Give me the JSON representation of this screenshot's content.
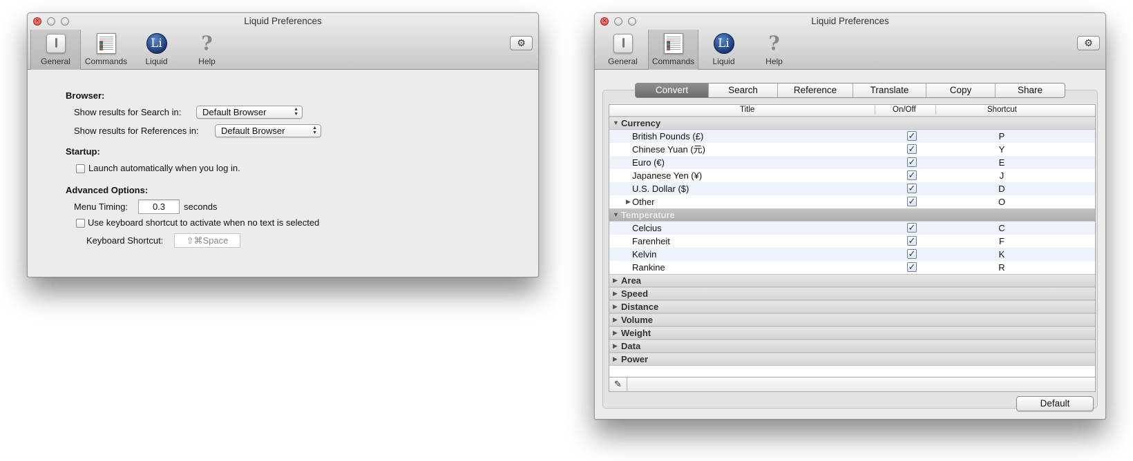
{
  "window_left": {
    "title": "Liquid Preferences",
    "toolbar": [
      {
        "label": "General",
        "icon": "general-icon",
        "selected": true
      },
      {
        "label": "Commands",
        "icon": "commands-icon",
        "selected": false
      },
      {
        "label": "Liquid",
        "icon": "liquid-icon",
        "selected": false
      },
      {
        "label": "Help",
        "icon": "help-icon",
        "selected": false
      }
    ],
    "liquid_icon_glyph": "Li",
    "help_icon_glyph": "?",
    "gear_glyph": "⚙",
    "browser": {
      "heading": "Browser:",
      "search_label": "Show results for Search in:",
      "search_value": "Default Browser",
      "references_label": "Show results for References in:",
      "references_value": "Default Browser"
    },
    "startup": {
      "heading": "Startup:",
      "launch_label": "Launch automatically when you log in."
    },
    "advanced": {
      "heading": "Advanced Options:",
      "menu_timing_label": "Menu Timing:",
      "menu_timing_value": "0.3",
      "menu_timing_unit": "seconds",
      "shortcut_checkbox_label": "Use keyboard shortcut to activate when no text is selected",
      "keyboard_shortcut_label": "Keyboard Shortcut:",
      "keyboard_shortcut_value": "⇧⌘Space"
    }
  },
  "window_right": {
    "title": "Liquid Preferences",
    "toolbar": [
      {
        "label": "General",
        "icon": "general-icon",
        "selected": false
      },
      {
        "label": "Commands",
        "icon": "commands-icon",
        "selected": true
      },
      {
        "label": "Liquid",
        "icon": "liquid-icon",
        "selected": false
      },
      {
        "label": "Help",
        "icon": "help-icon",
        "selected": false
      }
    ],
    "liquid_icon_glyph": "Li",
    "help_icon_glyph": "?",
    "gear_glyph": "⚙",
    "tabs": [
      "Convert",
      "Search",
      "Reference",
      "Translate",
      "Copy",
      "Share"
    ],
    "active_tab": "Convert",
    "columns": [
      "Title",
      "On/Off",
      "Shortcut"
    ],
    "rows": [
      {
        "type": "group",
        "label": "Currency",
        "expanded": true,
        "selected": false
      },
      {
        "type": "item",
        "label": "British Pounds (£)",
        "checked": true,
        "shortcut": "P"
      },
      {
        "type": "item",
        "label": "Chinese Yuan (元)",
        "checked": true,
        "shortcut": "Y"
      },
      {
        "type": "item",
        "label": "Euro (€)",
        "checked": true,
        "shortcut": "E"
      },
      {
        "type": "item",
        "label": "Japanese Yen (¥)",
        "checked": true,
        "shortcut": "J"
      },
      {
        "type": "item",
        "label": "U.S. Dollar ($)",
        "checked": true,
        "shortcut": "D"
      },
      {
        "type": "subgroup",
        "label": "Other",
        "checked": true,
        "shortcut": "O"
      },
      {
        "type": "group",
        "label": "Temperature",
        "expanded": true,
        "selected": true
      },
      {
        "type": "item",
        "label": "Celcius",
        "checked": true,
        "shortcut": "C"
      },
      {
        "type": "item",
        "label": "Farenheit",
        "checked": true,
        "shortcut": "F"
      },
      {
        "type": "item",
        "label": "Kelvin",
        "checked": true,
        "shortcut": "K"
      },
      {
        "type": "item",
        "label": "Rankine",
        "checked": true,
        "shortcut": "R"
      },
      {
        "type": "group",
        "label": "Area",
        "expanded": false,
        "selected": false
      },
      {
        "type": "group",
        "label": "Speed",
        "expanded": false,
        "selected": false
      },
      {
        "type": "group",
        "label": "Distance",
        "expanded": false,
        "selected": false
      },
      {
        "type": "group",
        "label": "Volume",
        "expanded": false,
        "selected": false
      },
      {
        "type": "group",
        "label": "Weight",
        "expanded": false,
        "selected": false
      },
      {
        "type": "group",
        "label": "Data",
        "expanded": false,
        "selected": false
      },
      {
        "type": "group",
        "label": "Power",
        "expanded": false,
        "selected": false
      }
    ],
    "pencil_glyph": "✎",
    "default_button": "Default"
  }
}
